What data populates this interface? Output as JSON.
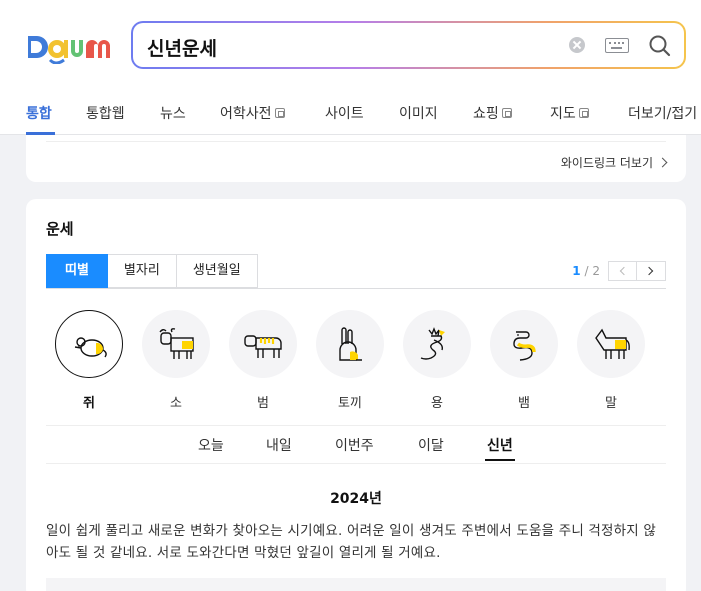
{
  "search": {
    "query": "신년운세"
  },
  "tabs": [
    {
      "label": "통합",
      "active": true
    },
    {
      "label": "통합웹"
    },
    {
      "label": "뉴스"
    },
    {
      "label": "어학사전",
      "external": true
    },
    {
      "label": "사이트"
    },
    {
      "label": "이미지"
    },
    {
      "label": "쇼핑",
      "external": true
    },
    {
      "label": "지도",
      "external": true
    },
    {
      "label": "더보기/접기"
    }
  ],
  "wide_link": {
    "label": "와이드링크 더보기"
  },
  "fortune_card": {
    "title": "운세",
    "subtabs": [
      "띠별",
      "별자리",
      "생년월일"
    ],
    "pager": {
      "current": "1",
      "separator": "/",
      "total": "2"
    },
    "zodiacs": [
      {
        "name": "쥐",
        "icon": "rat-icon",
        "active": true
      },
      {
        "name": "소",
        "icon": "ox-icon"
      },
      {
        "name": "범",
        "icon": "tiger-icon"
      },
      {
        "name": "토끼",
        "icon": "rabbit-icon"
      },
      {
        "name": "용",
        "icon": "dragon-icon"
      },
      {
        "name": "뱀",
        "icon": "snake-icon"
      },
      {
        "name": "말",
        "icon": "horse-icon"
      }
    ],
    "periods": [
      "오늘",
      "내일",
      "이번주",
      "이달",
      "신년"
    ],
    "active_period": "신년",
    "year": "2024년",
    "fortune_text": "일이 쉽게 풀리고 새로운 변화가 찾아오는 시기예요. 어려운 일이 생겨도 주변에서 도움을 주니 걱정하지 않아도 될 것 같네요. 서로 도와간다면 막혔던 앞길이 열리게 될 거예요."
  },
  "colors": {
    "accent": "#1a8cff",
    "tab_active": "#3a70d9",
    "highlight": "#ffd400"
  }
}
